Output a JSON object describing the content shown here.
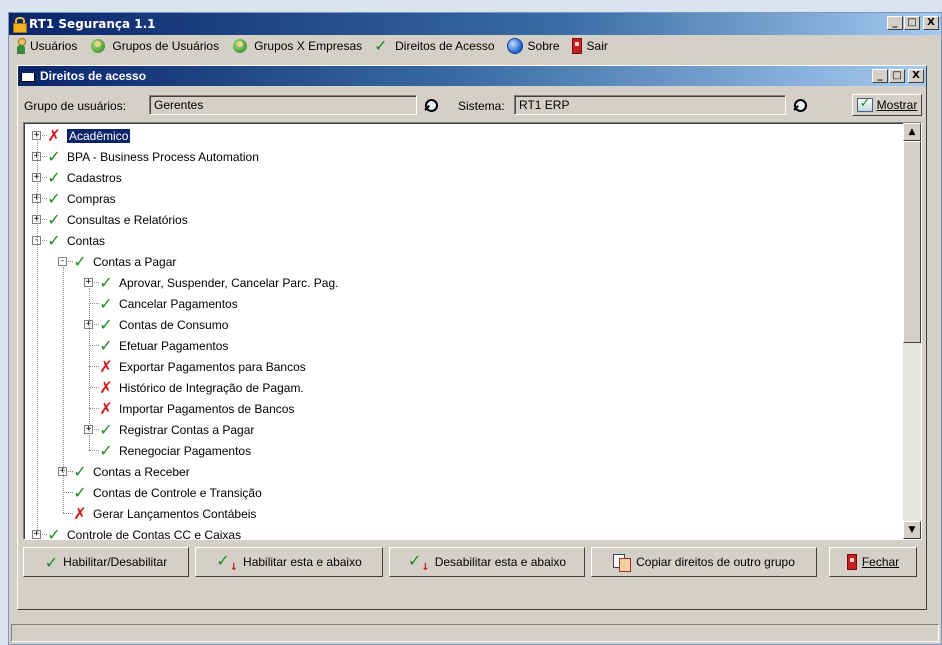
{
  "app": {
    "title": "RT1 Segurança 1.1"
  },
  "window_controls": {
    "minimize": "_",
    "maximize": "□",
    "close": "X"
  },
  "menu": {
    "items": [
      {
        "label": "Usuários",
        "icon": "user-icon"
      },
      {
        "label": "Grupos de Usuários",
        "icon": "group-icon"
      },
      {
        "label": "Grupos X Empresas",
        "icon": "group-icon"
      },
      {
        "label": "Direitos de Acesso",
        "icon": "check-icon"
      },
      {
        "label": "Sobre",
        "icon": "globe-icon"
      },
      {
        "label": "Sair",
        "icon": "exit-door-icon"
      }
    ]
  },
  "dialog": {
    "title": "Direitos de acesso",
    "grupo_label": "Grupo de usuários:",
    "grupo_value": "Gerentes",
    "sistema_label": "Sistema:",
    "sistema_value": "RT1 ERP",
    "mostrar_label": "Mostrar"
  },
  "tree": [
    {
      "label": "Acadêmico",
      "status": "denied",
      "expander": "+",
      "selected": true
    },
    {
      "label": "BPA - Business Process Automation",
      "status": "allowed",
      "expander": "+"
    },
    {
      "label": "Cadastros",
      "status": "allowed",
      "expander": "+"
    },
    {
      "label": "Compras",
      "status": "allowed",
      "expander": "+"
    },
    {
      "label": "Consultas e Relatórios",
      "status": "allowed",
      "expander": "+"
    },
    {
      "label": "Contas",
      "status": "allowed",
      "expander": "-"
    },
    {
      "label": "Contas a Pagar",
      "status": "allowed",
      "expander": "-"
    },
    {
      "label": "Aprovar, Suspender, Cancelar Parc. Pag.",
      "status": "allowed",
      "expander": "+"
    },
    {
      "label": "Cancelar Pagamentos",
      "status": "allowed",
      "expander": ""
    },
    {
      "label": "Contas de Consumo",
      "status": "allowed",
      "expander": "+"
    },
    {
      "label": "Efetuar Pagamentos",
      "status": "allowed",
      "expander": ""
    },
    {
      "label": "Exportar Pagamentos para Bancos",
      "status": "denied",
      "expander": ""
    },
    {
      "label": "Histórico de Integração de Pagam.",
      "status": "denied",
      "expander": ""
    },
    {
      "label": "Importar Pagamentos de Bancos",
      "status": "denied",
      "expander": ""
    },
    {
      "label": "Registrar Contas a Pagar",
      "status": "allowed",
      "expander": "+"
    },
    {
      "label": "Renegociar Pagamentos",
      "status": "allowed",
      "expander": ""
    },
    {
      "label": "Contas a Receber",
      "status": "allowed",
      "expander": "+"
    },
    {
      "label": "Contas de Controle e Transição",
      "status": "allowed",
      "expander": ""
    },
    {
      "label": "Gerar Lançamentos Contábeis",
      "status": "denied",
      "expander": ""
    },
    {
      "label": "Controle de Contas CC e Caixas",
      "status": "allowed",
      "expander": "+"
    }
  ],
  "buttons": {
    "habilitar_desabilitar": "Habilitar/Desabilitar",
    "habilitar_abaixo": "Habilitar esta e abaixo",
    "desabilitar_abaixo": "Desabilitar esta e abaixo",
    "copiar": "Copiar direitos de outro grupo",
    "fechar": "Fechar"
  },
  "colors": {
    "title_bar": "#0a246a",
    "allowed": "#1f8a1f",
    "denied": "#d01818",
    "face": "#d4d0c8"
  }
}
